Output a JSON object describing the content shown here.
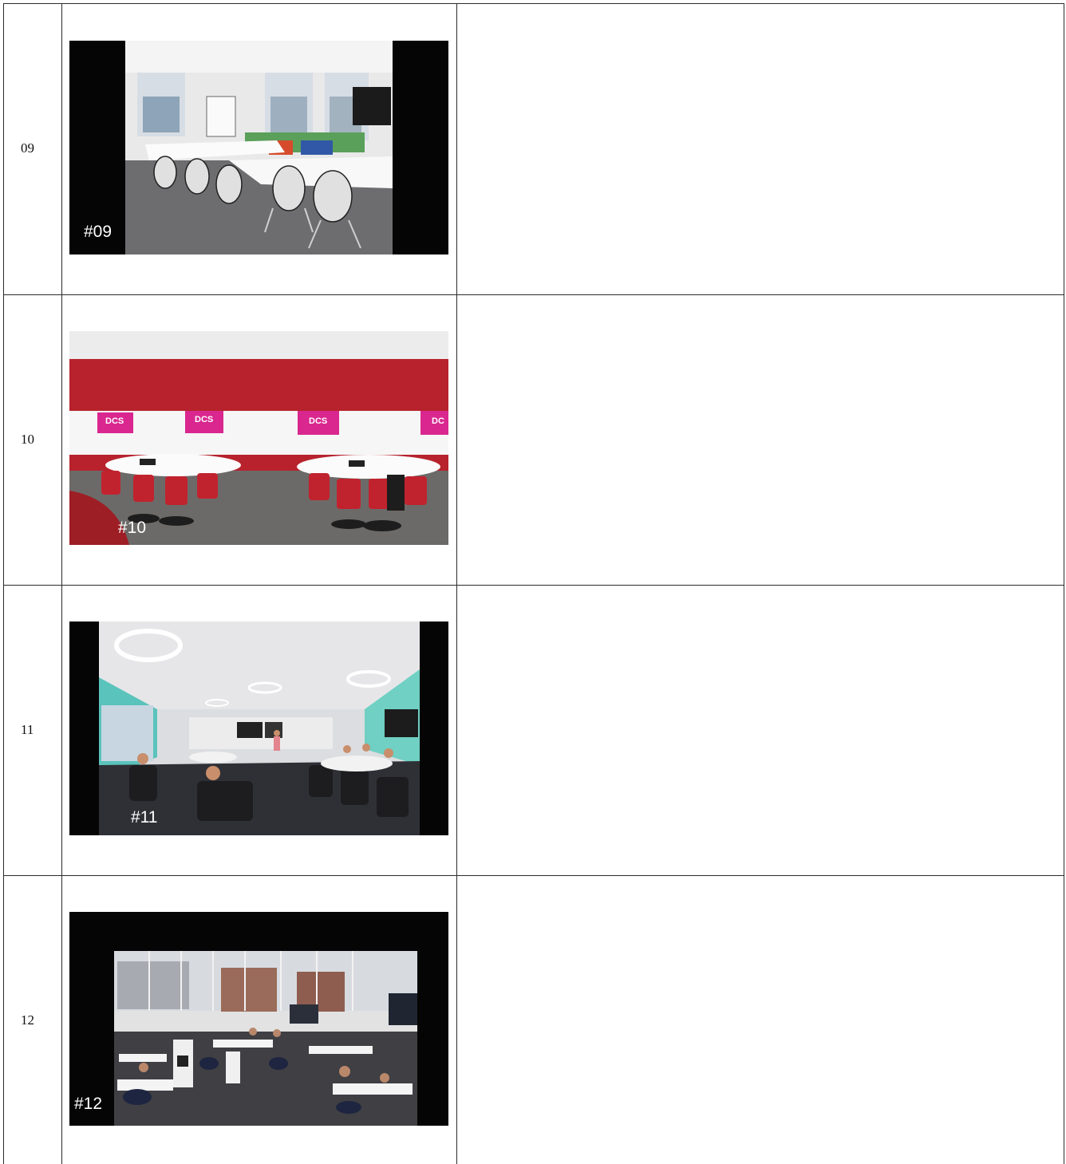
{
  "rows": [
    {
      "number": "09",
      "tag": "#09"
    },
    {
      "number": "10",
      "tag": "#10"
    },
    {
      "number": "11",
      "tag": "#11"
    },
    {
      "number": "12",
      "tag": "#12"
    }
  ],
  "photo_text": {
    "dcs": "DCS",
    "dcs_partial": "DC"
  }
}
